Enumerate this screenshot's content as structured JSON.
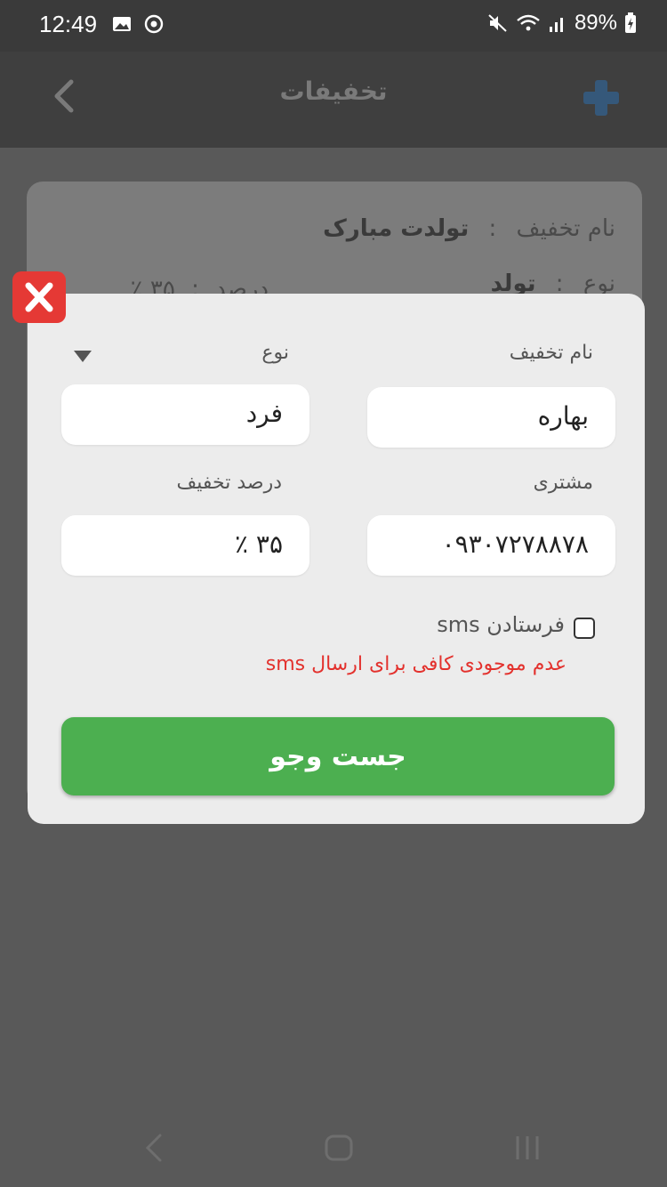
{
  "status_bar": {
    "time": "12:49",
    "battery": "89%"
  },
  "header": {
    "title": "تخفیفات"
  },
  "background_card": {
    "row1_label": "نام تخفیف",
    "row1_sep": ":",
    "row1_value": "تولدت مبارک",
    "row2_label": "نوع",
    "row2_sep": ":",
    "row2_value": "تولد",
    "row3_label": "درصد",
    "row3_sep": ":",
    "row3_value": "۳۵ ٪"
  },
  "dialog": {
    "name_label": "نام تخفیف",
    "name_value": "بهاره",
    "type_label": "نوع",
    "type_value": "فرد",
    "customer_label": "مشتری",
    "customer_value": "۰۹۳۰۷۲۷۸۸۷۸",
    "percent_label": "درصد تخفیف",
    "percent_value": "۳۵ ٪",
    "sms_label": "فرستادن sms",
    "sms_checked": false,
    "error_text": "عدم موجودی کافی برای ارسال sms",
    "submit_label": "جست وجو"
  },
  "colors": {
    "accent": "#4caf50",
    "error": "#e3312d",
    "close": "#e53935"
  }
}
